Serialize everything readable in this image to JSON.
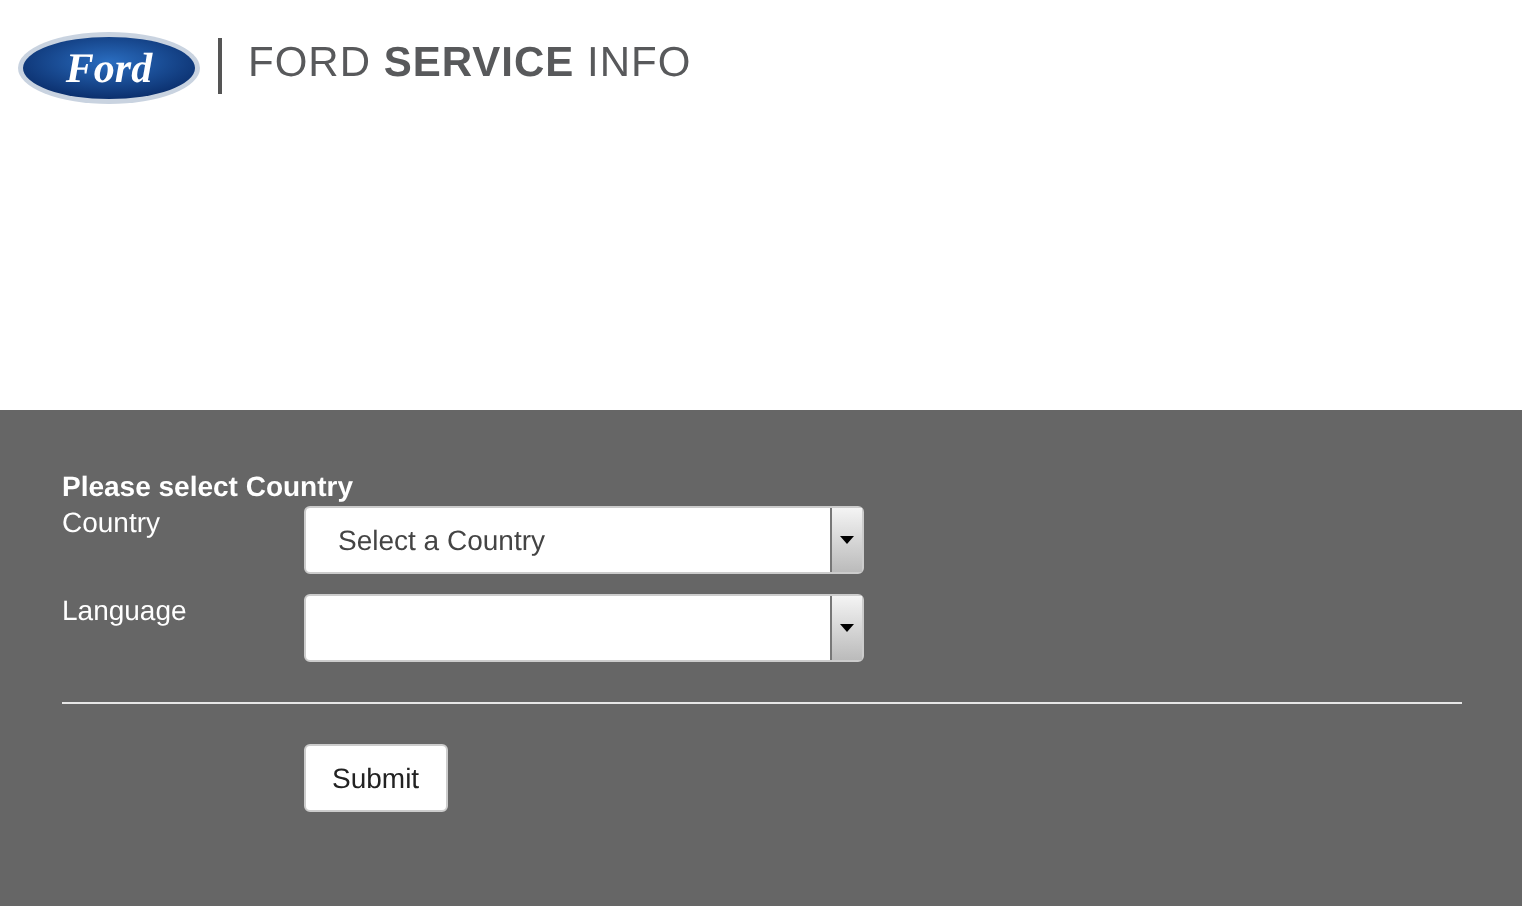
{
  "header": {
    "logo_text": "Ford",
    "title": "FORD **SERVICE** INFO"
  },
  "form": {
    "heading": "Please select Country",
    "fields": [
      {
        "label": "Country",
        "value": "Select a Country"
      },
      {
        "label": "Language"
      }
    ],
    "submit": "Submit"
  }
}
